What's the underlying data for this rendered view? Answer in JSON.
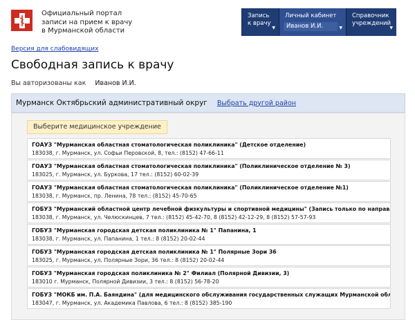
{
  "header": {
    "logo_icon": "medical-cross-icon",
    "brand_color": "#cc2c22",
    "portal_title_lines": [
      "Официальный портал",
      "записи на прием к врачу",
      "в Мурманской области"
    ]
  },
  "nav": {
    "record": {
      "lines": [
        "Запись",
        "к врачу"
      ],
      "caret": "▼"
    },
    "cabinet": {
      "label": "Личный кабинет",
      "user": "Иванов И.И.",
      "caret": "▼"
    },
    "directory": {
      "lines": [
        "Справочник",
        "учреждений"
      ],
      "caret": "▼"
    }
  },
  "accessibility_link": "Версия для слабовидящих",
  "page_title": "Свободная запись к врачу",
  "auth": {
    "label": "Вы авторизованы как",
    "user": "Иванов И.И."
  },
  "district": {
    "name": "Мурманск Октябрьский административный округ",
    "change_link": "Выбрать другой район"
  },
  "select_label": "Выберите медицинское учреждение",
  "clinics": [
    {
      "name": "ГОАУЗ \"Мурманская областная стоматологическая поликлиника\" (Детское отделение)",
      "address": "183038, г. Мурманск, ул. Софьи Перовской, 8, тел.: (8152) 47-66-11"
    },
    {
      "name": "ГОАУЗ \"Мурманская областная стоматологическая поликлиника\" (Поликлиническое отделение № 3)",
      "address": "183025, г. Мурманск, ул. Буркова, 17 тел.: (8152) 60-02-39"
    },
    {
      "name": "ГОАУЗ \"Мурманская областная стоматологическая поликлиника\" (Поликлиническое отделение №1)",
      "address": "183038, г. Мурманск, пр. Ленина, 78 тел.: (8152) 45-70-65"
    },
    {
      "name": "ГОБУЗ \"Мурманский областной центр лечебной физкультуры и спортивной медицины\" (Запись только по направлению)",
      "address": "183038, г. Мурманск, ул. Челюскинцев, 7 тел.: (8152) 45-42-70, 8 (8152) 42-12-29, 8 (8152) 57-57-93"
    },
    {
      "name": "ГОБУЗ \"Мурманская городская детская поликлиника № 1\" Папанина, 1",
      "address": "183038, г. Мурманск, ул. Папанина, 1 тел.: 8 (8152) 20-02-44"
    },
    {
      "name": "ГОБУЗ \"Мурманская городская детская поликлиника № 1\" Полярные Зори 36",
      "address": "183025, г. Мурманск, ул. Полярные Зори, 36 тел.: 8 (8152) 20-02-44"
    },
    {
      "name": "ГОБУЗ \"Мурманская городская поликлиника № 2\" Филиал (Полярной Дивизии, 3)",
      "address": "183010 г. Мурманск, Полярной Дивизии, 3 тел.: 8 (8152) 56-78-20"
    },
    {
      "name": "ГОБУЗ \"МОКБ им. П.А. Баяндина\" (для медицинского обслуживания государственных служащих Мурманской области)",
      "address": "183047, г. Мурманск, ул. Академика Павлова, 6 тел.: 8 (8152) 385-190"
    }
  ]
}
